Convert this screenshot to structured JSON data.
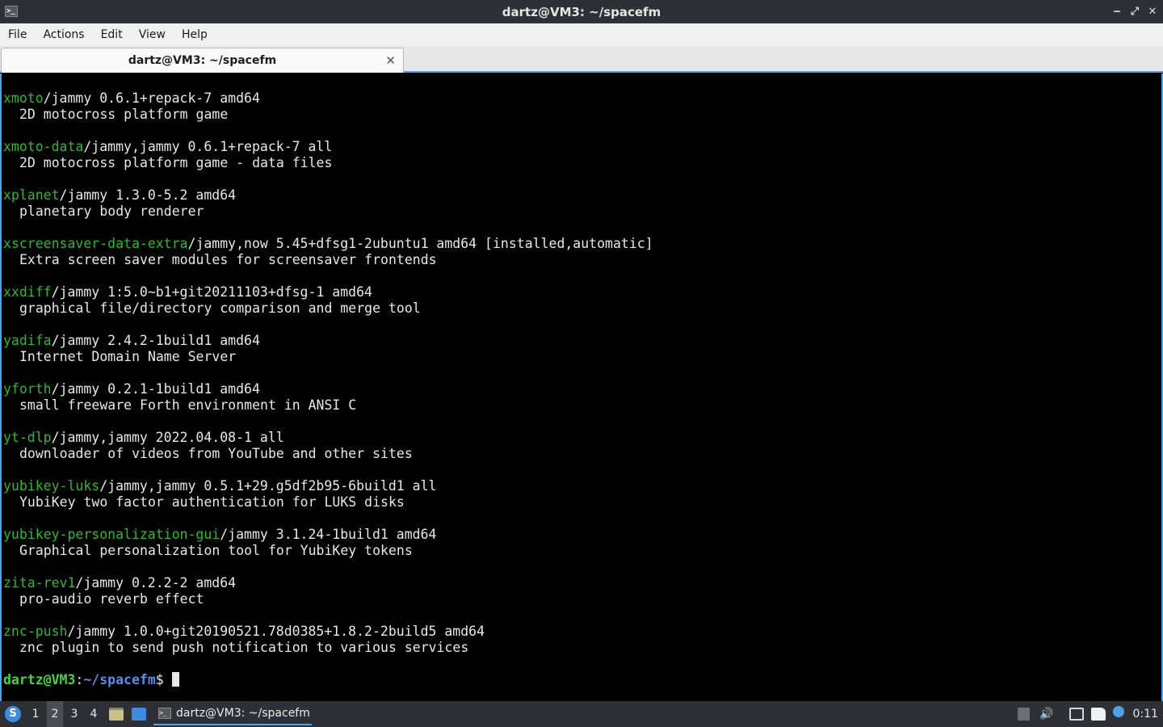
{
  "window": {
    "title": "dartz@VM3: ~/spacefm",
    "controls": {
      "minimize": "‒",
      "maximize": "⤢",
      "close": "✕"
    }
  },
  "menu": {
    "items": [
      "File",
      "Actions",
      "Edit",
      "View",
      "Help"
    ]
  },
  "tabs": [
    {
      "label": "dartz@VM3: ~/spacefm",
      "close": "✕"
    }
  ],
  "terminal": {
    "entries": [
      {
        "pkg": "xmoto",
        "rest": "/jammy 0.6.1+repack-7 amd64",
        "desc": "2D motocross platform game"
      },
      {
        "pkg": "xmoto-data",
        "rest": "/jammy,jammy 0.6.1+repack-7 all",
        "desc": "2D motocross platform game - data files"
      },
      {
        "pkg": "xplanet",
        "rest": "/jammy 1.3.0-5.2 amd64",
        "desc": "planetary body renderer"
      },
      {
        "pkg": "xscreensaver-data-extra",
        "rest": "/jammy,now 5.45+dfsg1-2ubuntu1 amd64 [installed,automatic]",
        "desc": "Extra screen saver modules for screensaver frontends"
      },
      {
        "pkg": "xxdiff",
        "rest": "/jammy 1:5.0~b1+git20211103+dfsg-1 amd64",
        "desc": "graphical file/directory comparison and merge tool"
      },
      {
        "pkg": "yadifa",
        "rest": "/jammy 2.4.2-1build1 amd64",
        "desc": "Internet Domain Name Server"
      },
      {
        "pkg": "yforth",
        "rest": "/jammy 0.2.1-1build1 amd64",
        "desc": "small freeware Forth environment in ANSI C"
      },
      {
        "pkg": "yt-dlp",
        "rest": "/jammy,jammy 2022.04.08-1 all",
        "desc": "downloader of videos from YouTube and other sites"
      },
      {
        "pkg": "yubikey-luks",
        "rest": "/jammy,jammy 0.5.1+29.g5df2b95-6build1 all",
        "desc": "YubiKey two factor authentication for LUKS disks"
      },
      {
        "pkg": "yubikey-personalization-gui",
        "rest": "/jammy 3.1.24-1build1 amd64",
        "desc": "Graphical personalization tool for YubiKey tokens"
      },
      {
        "pkg": "zita-rev1",
        "rest": "/jammy 0.2.2-2 amd64",
        "desc": "pro-audio reverb effect"
      },
      {
        "pkg": "znc-push",
        "rest": "/jammy 1.0.0+git20190521.78d0385+1.8.2-2build5 amd64",
        "desc": "znc plugin to send push notification to various services"
      }
    ],
    "prompt": {
      "user": "dartz@VM3",
      "sep": ":",
      "path": "~/spacefm",
      "symbol": "$ "
    }
  },
  "taskbar": {
    "workspaces": [
      "1",
      "2",
      "3",
      "4"
    ],
    "active_workspace": "2",
    "task_label": "dartz@VM3: ~/spacefm",
    "clock": "0:11"
  },
  "colors": {
    "accent": "#4ba3e8",
    "package_name": "#2fb82f",
    "prompt_user": "#47d247",
    "prompt_path": "#5b8be8"
  }
}
